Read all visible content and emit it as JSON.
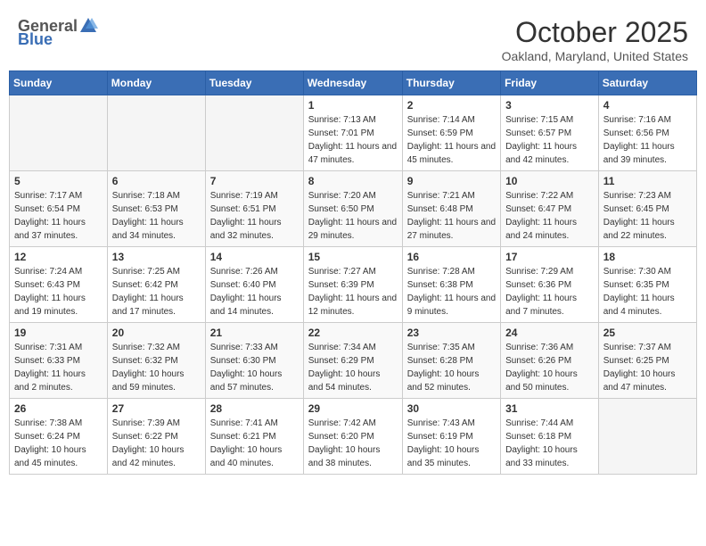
{
  "header": {
    "logo": {
      "text_general": "General",
      "text_blue": "Blue"
    },
    "title": "October 2025",
    "location": "Oakland, Maryland, United States"
  },
  "days_of_week": [
    "Sunday",
    "Monday",
    "Tuesday",
    "Wednesday",
    "Thursday",
    "Friday",
    "Saturday"
  ],
  "weeks": [
    [
      {
        "day": "",
        "info": ""
      },
      {
        "day": "",
        "info": ""
      },
      {
        "day": "",
        "info": ""
      },
      {
        "day": "1",
        "info": "Sunrise: 7:13 AM\nSunset: 7:01 PM\nDaylight: 11 hours and 47 minutes."
      },
      {
        "day": "2",
        "info": "Sunrise: 7:14 AM\nSunset: 6:59 PM\nDaylight: 11 hours and 45 minutes."
      },
      {
        "day": "3",
        "info": "Sunrise: 7:15 AM\nSunset: 6:57 PM\nDaylight: 11 hours and 42 minutes."
      },
      {
        "day": "4",
        "info": "Sunrise: 7:16 AM\nSunset: 6:56 PM\nDaylight: 11 hours and 39 minutes."
      }
    ],
    [
      {
        "day": "5",
        "info": "Sunrise: 7:17 AM\nSunset: 6:54 PM\nDaylight: 11 hours and 37 minutes."
      },
      {
        "day": "6",
        "info": "Sunrise: 7:18 AM\nSunset: 6:53 PM\nDaylight: 11 hours and 34 minutes."
      },
      {
        "day": "7",
        "info": "Sunrise: 7:19 AM\nSunset: 6:51 PM\nDaylight: 11 hours and 32 minutes."
      },
      {
        "day": "8",
        "info": "Sunrise: 7:20 AM\nSunset: 6:50 PM\nDaylight: 11 hours and 29 minutes."
      },
      {
        "day": "9",
        "info": "Sunrise: 7:21 AM\nSunset: 6:48 PM\nDaylight: 11 hours and 27 minutes."
      },
      {
        "day": "10",
        "info": "Sunrise: 7:22 AM\nSunset: 6:47 PM\nDaylight: 11 hours and 24 minutes."
      },
      {
        "day": "11",
        "info": "Sunrise: 7:23 AM\nSunset: 6:45 PM\nDaylight: 11 hours and 22 minutes."
      }
    ],
    [
      {
        "day": "12",
        "info": "Sunrise: 7:24 AM\nSunset: 6:43 PM\nDaylight: 11 hours and 19 minutes."
      },
      {
        "day": "13",
        "info": "Sunrise: 7:25 AM\nSunset: 6:42 PM\nDaylight: 11 hours and 17 minutes."
      },
      {
        "day": "14",
        "info": "Sunrise: 7:26 AM\nSunset: 6:40 PM\nDaylight: 11 hours and 14 minutes."
      },
      {
        "day": "15",
        "info": "Sunrise: 7:27 AM\nSunset: 6:39 PM\nDaylight: 11 hours and 12 minutes."
      },
      {
        "day": "16",
        "info": "Sunrise: 7:28 AM\nSunset: 6:38 PM\nDaylight: 11 hours and 9 minutes."
      },
      {
        "day": "17",
        "info": "Sunrise: 7:29 AM\nSunset: 6:36 PM\nDaylight: 11 hours and 7 minutes."
      },
      {
        "day": "18",
        "info": "Sunrise: 7:30 AM\nSunset: 6:35 PM\nDaylight: 11 hours and 4 minutes."
      }
    ],
    [
      {
        "day": "19",
        "info": "Sunrise: 7:31 AM\nSunset: 6:33 PM\nDaylight: 11 hours and 2 minutes."
      },
      {
        "day": "20",
        "info": "Sunrise: 7:32 AM\nSunset: 6:32 PM\nDaylight: 10 hours and 59 minutes."
      },
      {
        "day": "21",
        "info": "Sunrise: 7:33 AM\nSunset: 6:30 PM\nDaylight: 10 hours and 57 minutes."
      },
      {
        "day": "22",
        "info": "Sunrise: 7:34 AM\nSunset: 6:29 PM\nDaylight: 10 hours and 54 minutes."
      },
      {
        "day": "23",
        "info": "Sunrise: 7:35 AM\nSunset: 6:28 PM\nDaylight: 10 hours and 52 minutes."
      },
      {
        "day": "24",
        "info": "Sunrise: 7:36 AM\nSunset: 6:26 PM\nDaylight: 10 hours and 50 minutes."
      },
      {
        "day": "25",
        "info": "Sunrise: 7:37 AM\nSunset: 6:25 PM\nDaylight: 10 hours and 47 minutes."
      }
    ],
    [
      {
        "day": "26",
        "info": "Sunrise: 7:38 AM\nSunset: 6:24 PM\nDaylight: 10 hours and 45 minutes."
      },
      {
        "day": "27",
        "info": "Sunrise: 7:39 AM\nSunset: 6:22 PM\nDaylight: 10 hours and 42 minutes."
      },
      {
        "day": "28",
        "info": "Sunrise: 7:41 AM\nSunset: 6:21 PM\nDaylight: 10 hours and 40 minutes."
      },
      {
        "day": "29",
        "info": "Sunrise: 7:42 AM\nSunset: 6:20 PM\nDaylight: 10 hours and 38 minutes."
      },
      {
        "day": "30",
        "info": "Sunrise: 7:43 AM\nSunset: 6:19 PM\nDaylight: 10 hours and 35 minutes."
      },
      {
        "day": "31",
        "info": "Sunrise: 7:44 AM\nSunset: 6:18 PM\nDaylight: 10 hours and 33 minutes."
      },
      {
        "day": "",
        "info": ""
      }
    ]
  ]
}
